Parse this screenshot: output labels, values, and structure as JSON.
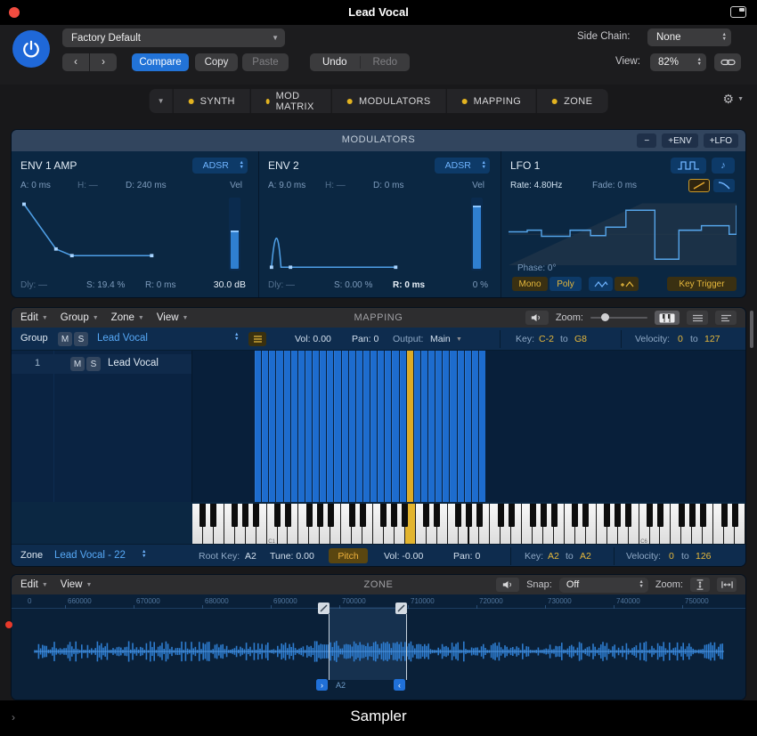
{
  "window": {
    "title": "Lead Vocal",
    "app": "Sampler"
  },
  "header": {
    "preset": "Factory Default",
    "side_chain_label": "Side Chain:",
    "side_chain_value": "None",
    "compare": "Compare",
    "copy": "Copy",
    "paste": "Paste",
    "undo": "Undo",
    "redo": "Redo",
    "view_label": "View:",
    "view_value": "82%"
  },
  "tabs": [
    "SYNTH",
    "MOD MATRIX",
    "MODULATORS",
    "MAPPING",
    "ZONE"
  ],
  "modulators": {
    "title": "MODULATORS",
    "add_env": "+ENV",
    "add_lfo": "+LFO",
    "env1": {
      "name": "ENV 1 AMP",
      "mode": "ADSR",
      "attack": "A: 0 ms",
      "hold": "H: —",
      "decay": "D: 240 ms",
      "vel": "Vel",
      "delay": "Dly: —",
      "sustain": "S: 19.4 %",
      "release": "R: 0 ms",
      "amount": "30.0 dB"
    },
    "env2": {
      "name": "ENV 2",
      "mode": "ADSR",
      "attack": "A: 9.0 ms",
      "hold": "H: —",
      "decay": "D: 0 ms",
      "vel": "Vel",
      "delay": "Dly: —",
      "sustain": "S: 0.00 %",
      "release": "R: 0 ms",
      "amount": "0 %"
    },
    "lfo1": {
      "name": "LFO 1",
      "rate": "Rate: 4.80Hz",
      "fade": "Fade: 0 ms",
      "phase": "Phase: 0°",
      "mono": "Mono",
      "poly": "Poly",
      "key_trigger": "Key Trigger"
    }
  },
  "mapping": {
    "title": "MAPPING",
    "menus": [
      "Edit",
      "Group",
      "Zone",
      "View"
    ],
    "zoom_label": "Zoom:",
    "group_col": "Group",
    "mute": "M",
    "solo": "S",
    "group_name": "Lead Vocal",
    "group_vol": "Vol: 0.00",
    "group_pan": "Pan: 0",
    "output_label": "Output:",
    "output_value": "Main",
    "key_label": "Key:",
    "key_low": "C-2",
    "to": "to",
    "key_high": "G8",
    "vel_label": "Velocity:",
    "vel_low": "0",
    "vel_high": "127",
    "row_num": "1",
    "row_name": "Lead Vocal",
    "kb_label_c1": "C1",
    "kb_label_c6": "C6",
    "zone_label": "Zone",
    "zone_name": "Lead Vocal - 22",
    "root_key": "Root Key:",
    "root_key_value": "A2",
    "tune": "Tune: 0.00",
    "pitch": "Pitch",
    "zone_vol": "Vol: -0.00",
    "zone_pan": "Pan: 0",
    "zkey_label": "Key:",
    "zkey_low": "A2",
    "zkey_high": "A2",
    "zvel_label": "Velocity:",
    "zvel_low": "0",
    "zvel_high": "126"
  },
  "zone": {
    "title": "ZONE",
    "menus": [
      "Edit",
      "View"
    ],
    "snap_label": "Snap:",
    "snap_value": "Off",
    "zoom_label": "Zoom:",
    "ruler_partial": "0",
    "ruler": [
      "660000",
      "670000",
      "680000",
      "690000",
      "700000",
      "710000",
      "720000",
      "730000",
      "740000",
      "750000"
    ],
    "marker_note": "A2"
  }
}
